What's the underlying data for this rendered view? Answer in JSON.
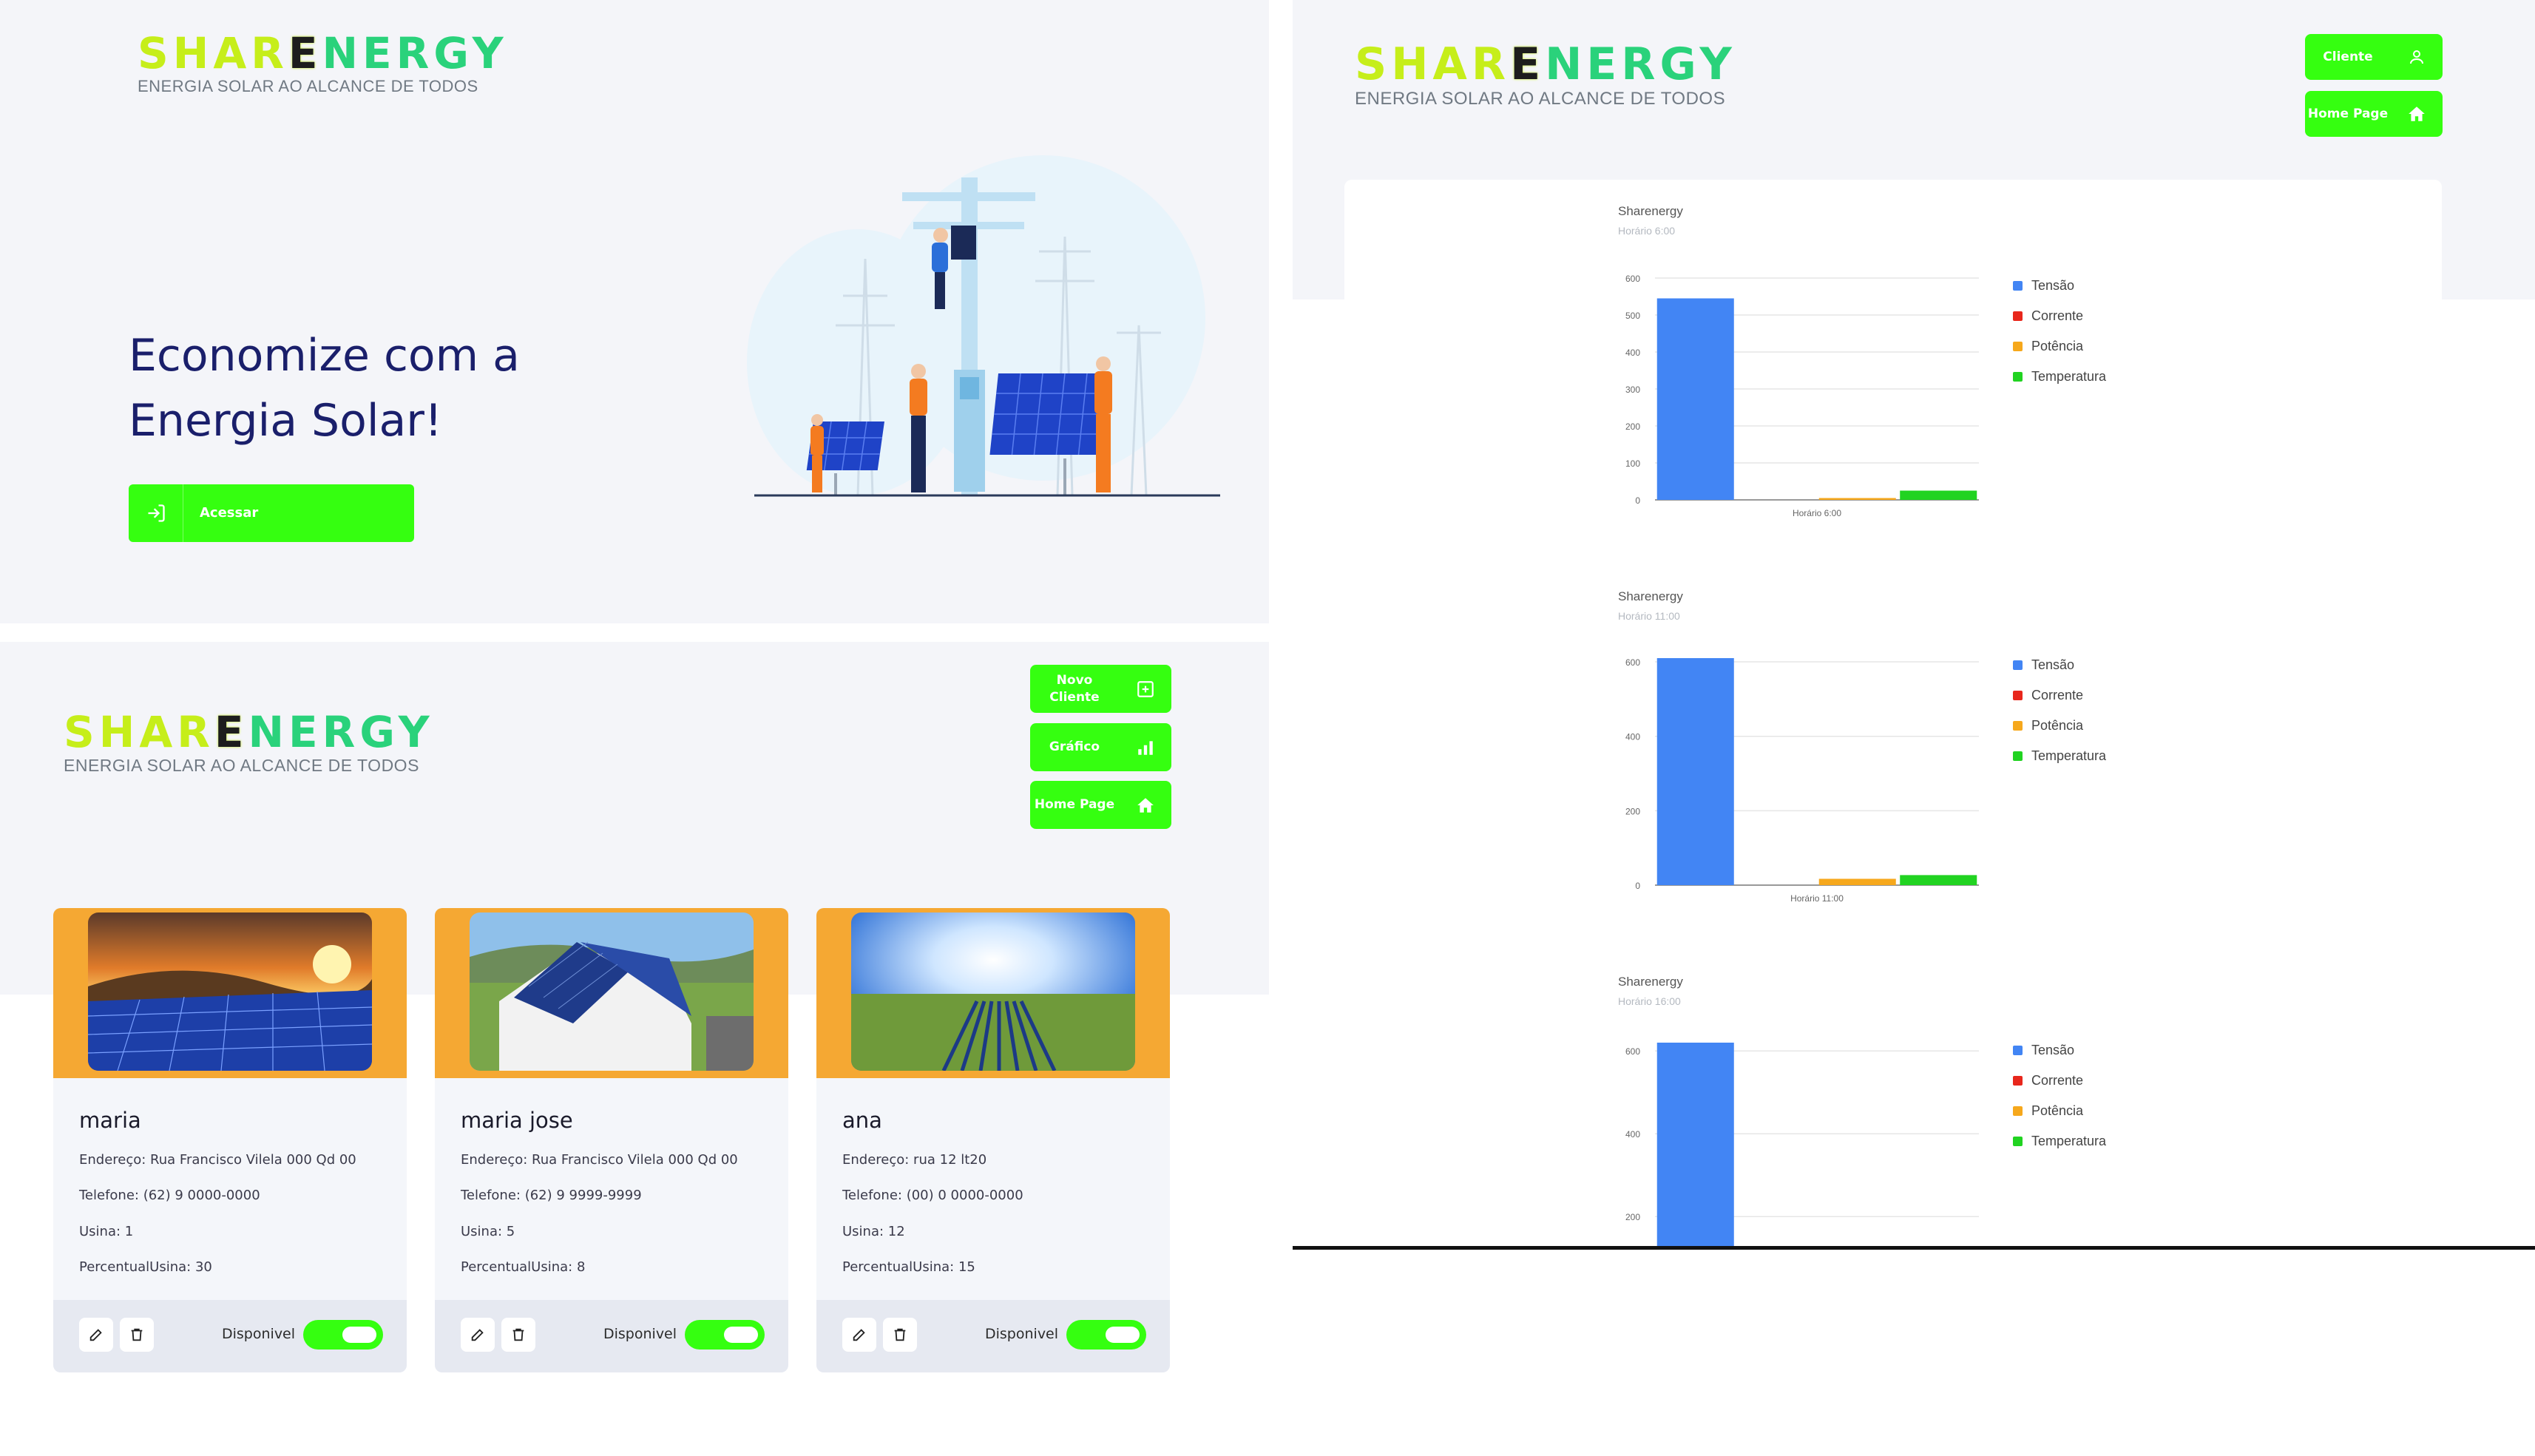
{
  "brand": {
    "name_part1": "SHAR",
    "name_part2": "E",
    "name_part3": "NERGY",
    "tagline": "ENERGIA SOLAR AO ALCANCE DE TODOS"
  },
  "colors": {
    "accent_green": "#35ff10",
    "card_header_orange": "#f5a833",
    "bar_tensao": "#4285f4",
    "bar_corrente": "#e8271c",
    "bar_potencia": "#f6a81c",
    "bar_temperatura": "#21d321"
  },
  "home": {
    "headline_line1": "Economize com a",
    "headline_line2": "Energia Solar!",
    "access_button": "Acessar"
  },
  "clients_page": {
    "nav": {
      "new_client": "Novo Cliente",
      "chart": "Gráfico",
      "home": "Home Page"
    },
    "cards": [
      {
        "name": "maria",
        "address": "Endereço: Rua Francisco Vilela 000 Qd 00",
        "phone": "Telefone: (62) 9 0000-0000",
        "plant": "Usina: 1",
        "percent": "PercentualUsina: 30",
        "status": "Disponivel",
        "available": true
      },
      {
        "name": "maria jose",
        "address": "Endereço: Rua Francisco Vilela 000 Qd 00",
        "phone": "Telefone: (62) 9 9999-9999",
        "plant": "Usina: 5",
        "percent": "PercentualUsina: 8",
        "status": "Disponivel",
        "available": true
      },
      {
        "name": "ana",
        "address": "Endereço: rua 12 lt20",
        "phone": "Telefone: (00) 0 0000-0000",
        "plant": "Usina: 12",
        "percent": "PercentualUsina: 15",
        "status": "Disponivel",
        "available": true
      }
    ]
  },
  "charts_page": {
    "nav": {
      "client": "Cliente",
      "home": "Home Page"
    },
    "legend": [
      "Tensão",
      "Corrente",
      "Potência",
      "Temperatura"
    ]
  },
  "chart_data": [
    {
      "type": "bar",
      "title": "Sharenergy",
      "subtitle": "Horário 6:00",
      "categories": [
        "Horário 6:00"
      ],
      "series": [
        {
          "name": "Tensão",
          "values": [
            545
          ]
        },
        {
          "name": "Corrente",
          "values": [
            0
          ]
        },
        {
          "name": "Potência",
          "values": [
            5
          ]
        },
        {
          "name": "Temperatura",
          "values": [
            25
          ]
        }
      ],
      "yticks": [
        "0",
        "100",
        "200",
        "300",
        "400",
        "500",
        "600"
      ],
      "ylim": [
        0,
        600
      ],
      "grid": true,
      "legend_position": "right"
    },
    {
      "type": "bar",
      "title": "Sharenergy",
      "subtitle": "Horário 11:00",
      "categories": [
        "Horário 11:00"
      ],
      "series": [
        {
          "name": "Tensão",
          "values": [
            610
          ]
        },
        {
          "name": "Corrente",
          "values": [
            0
          ]
        },
        {
          "name": "Potência",
          "values": [
            17
          ]
        },
        {
          "name": "Temperatura",
          "values": [
            27
          ]
        }
      ],
      "yticks": [
        "0",
        "200",
        "400",
        "600"
      ],
      "ylim": [
        0,
        610
      ],
      "grid": true,
      "legend_position": "right"
    },
    {
      "type": "bar",
      "title": "Sharenergy",
      "subtitle": "Horário 16:00",
      "categories": [
        "Horário 16:00"
      ],
      "series": [
        {
          "name": "Tensão",
          "values": [
            620
          ]
        },
        {
          "name": "Corrente",
          "values": [
            0
          ]
        },
        {
          "name": "Potência",
          "values": [
            0
          ]
        },
        {
          "name": "Temperatura",
          "values": [
            0
          ]
        }
      ],
      "yticks": [
        "200",
        "400",
        "600"
      ],
      "ylim": [
        120,
        620
      ],
      "grid": true,
      "legend_position": "right"
    }
  ]
}
